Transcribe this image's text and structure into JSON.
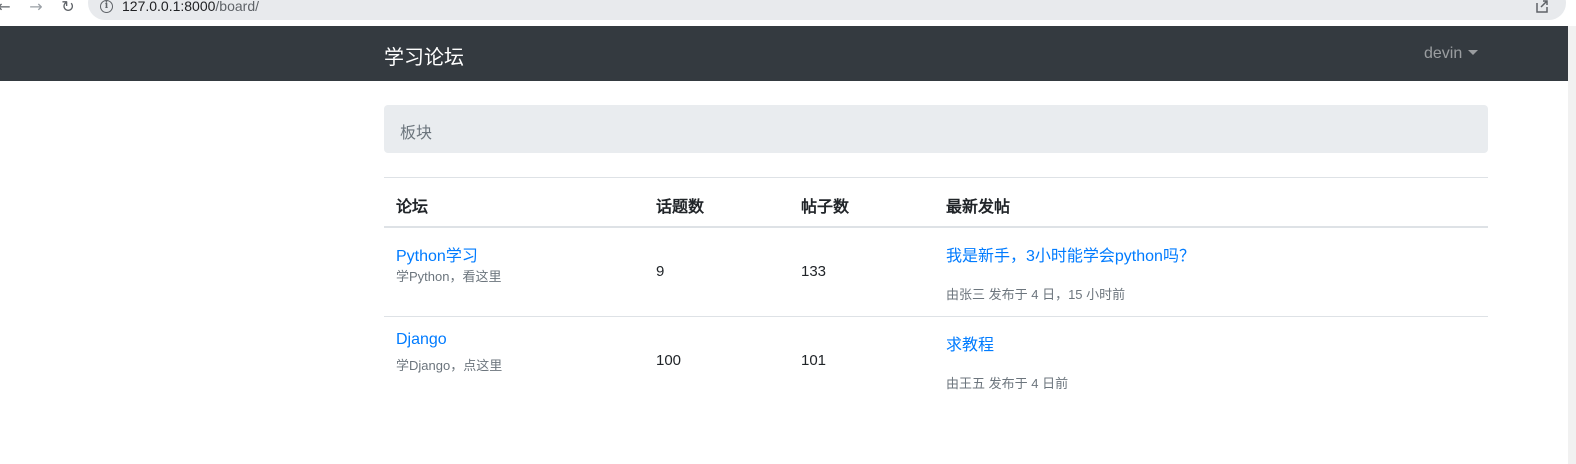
{
  "browser": {
    "url_host": "127.0.0.1:8000",
    "url_path": "/board/"
  },
  "navbar": {
    "brand": "学习论坛",
    "user": "devin"
  },
  "breadcrumb": {
    "current": "板块"
  },
  "table": {
    "headers": [
      "论坛",
      "话题数",
      "帖子数",
      "最新发帖"
    ],
    "rows": [
      {
        "name": "Python学习",
        "description": "学Python，看这里",
        "topics": "9",
        "posts": "133",
        "latest_title": "我是新手，3小时能学会python吗？",
        "latest_meta": "由张三 发布于 4 日，15 小时前"
      },
      {
        "name": "Django",
        "description": "学Django，点这里",
        "topics": "100",
        "posts": "101",
        "latest_title": "求教程",
        "latest_meta": "由王五 发布于 4 日前"
      }
    ]
  }
}
